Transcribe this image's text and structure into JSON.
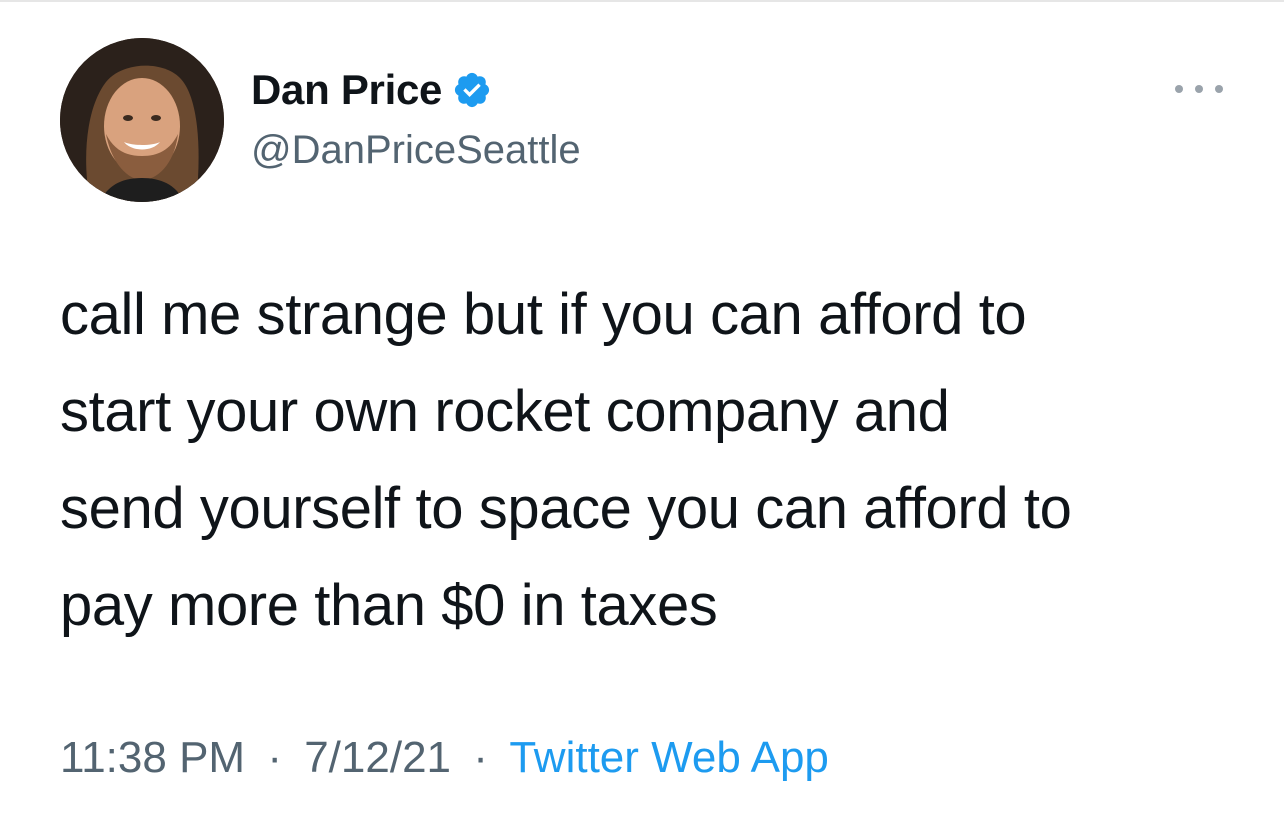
{
  "tweet": {
    "author": {
      "display_name": "Dan Price",
      "handle": "@DanPriceSeattle",
      "verified_icon": "verified-badge-icon",
      "avatar_icon": "profile-photo"
    },
    "text_lines": [
      "call me strange but if you can afford to",
      "start your own rocket company and",
      "send yourself to space you can afford to",
      "pay more than $0 in taxes"
    ],
    "time": "11:38 PM",
    "date": "7/12/21",
    "separator": "·",
    "source": "Twitter Web App",
    "more_icon": "more-options-icon"
  },
  "colors": {
    "text": "#0f1419",
    "secondary": "#536471",
    "link": "#1d9bf0",
    "verified": "#1d9bf0"
  }
}
